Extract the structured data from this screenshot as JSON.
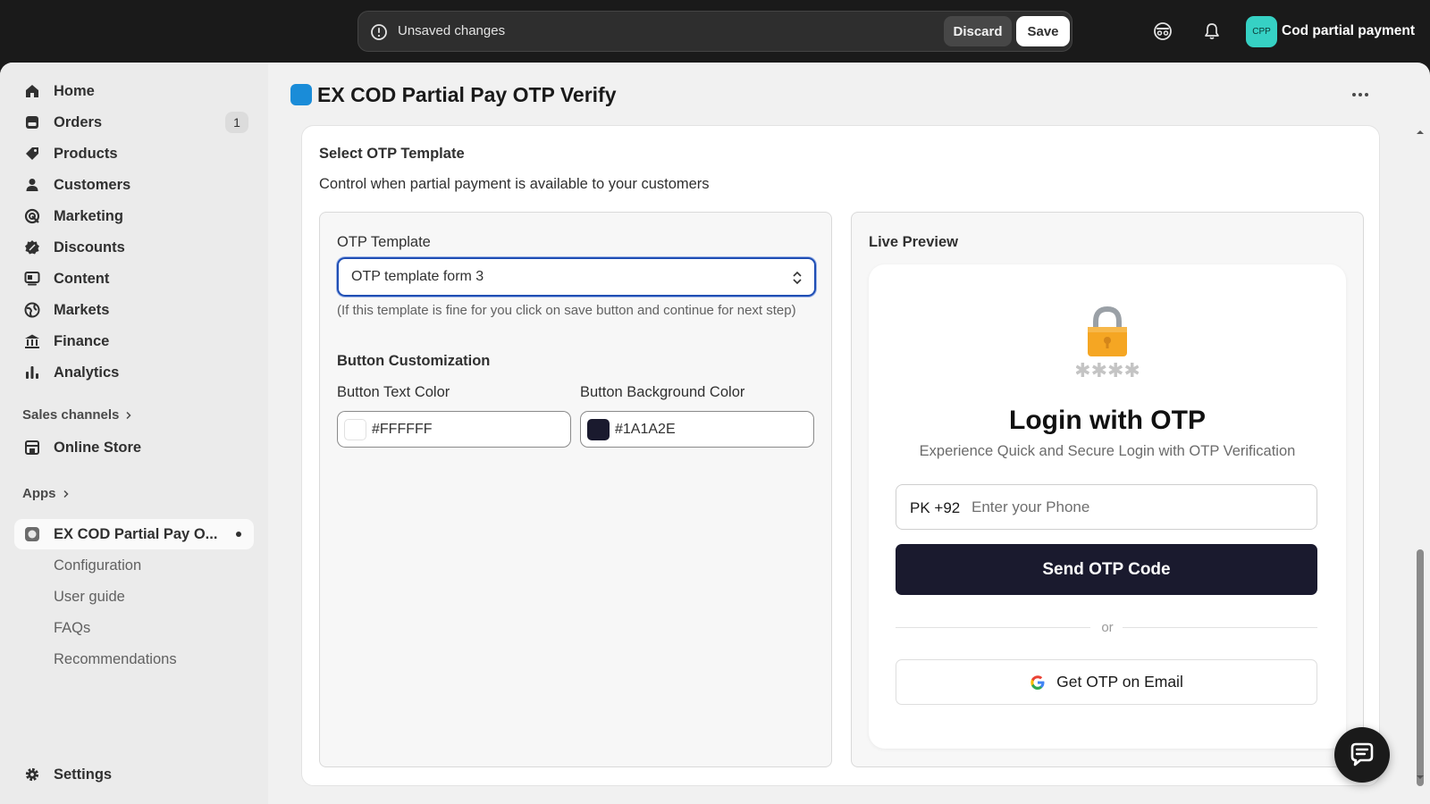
{
  "topbar": {
    "unsaved_text": "Unsaved changes",
    "discard_label": "Discard",
    "save_label": "Save",
    "store_initials": "CPP",
    "store_name": "Cod partial payment"
  },
  "sidebar": {
    "items": [
      {
        "label": "Home",
        "icon": "home-icon"
      },
      {
        "label": "Orders",
        "icon": "orders-icon",
        "badge": "1"
      },
      {
        "label": "Products",
        "icon": "tag-icon"
      },
      {
        "label": "Customers",
        "icon": "person-icon"
      },
      {
        "label": "Marketing",
        "icon": "target-icon"
      },
      {
        "label": "Discounts",
        "icon": "discount-icon"
      },
      {
        "label": "Content",
        "icon": "content-icon"
      },
      {
        "label": "Markets",
        "icon": "globe-icon"
      },
      {
        "label": "Finance",
        "icon": "bank-icon"
      },
      {
        "label": "Analytics",
        "icon": "chart-bar-icon"
      }
    ],
    "sales_channels_label": "Sales channels",
    "online_store_label": "Online Store",
    "apps_label": "Apps",
    "app_name": "EX COD Partial Pay O...",
    "app_subitems": [
      {
        "label": "Configuration"
      },
      {
        "label": "User guide"
      },
      {
        "label": "FAQs"
      },
      {
        "label": "Recommendations"
      }
    ],
    "settings_label": "Settings"
  },
  "main": {
    "page_title": "EX COD Partial Pay OTP Verify",
    "card_title": "Select OTP Template",
    "card_subtitle": "Control when partial payment is available to your customers",
    "otp_template_label": "OTP Template",
    "otp_template_value": "OTP template form 3",
    "help_text": "(If this template is fine for you click on save button and continue for next step)",
    "button_customization_label": "Button Customization",
    "text_color_label": "Button Text Color",
    "text_color_value": "#FFFFFF",
    "bg_color_label": "Button Background Color",
    "bg_color_value": "#1A1A2E",
    "live_preview_label": "Live Preview"
  },
  "preview": {
    "title": "Login with OTP",
    "subtitle": "Experience Quick and Secure Login with OTP Verification",
    "phone_prefix": "PK +92",
    "phone_placeholder": "Enter your Phone",
    "send_button": "Send OTP Code",
    "or_text": "or",
    "email_button": "Get OTP on Email"
  },
  "colors": {
    "accent_blue": "#1f4eb4",
    "button_bg": "#1A1A2E",
    "button_text": "#FFFFFF",
    "avatar": "#36d1c4"
  }
}
